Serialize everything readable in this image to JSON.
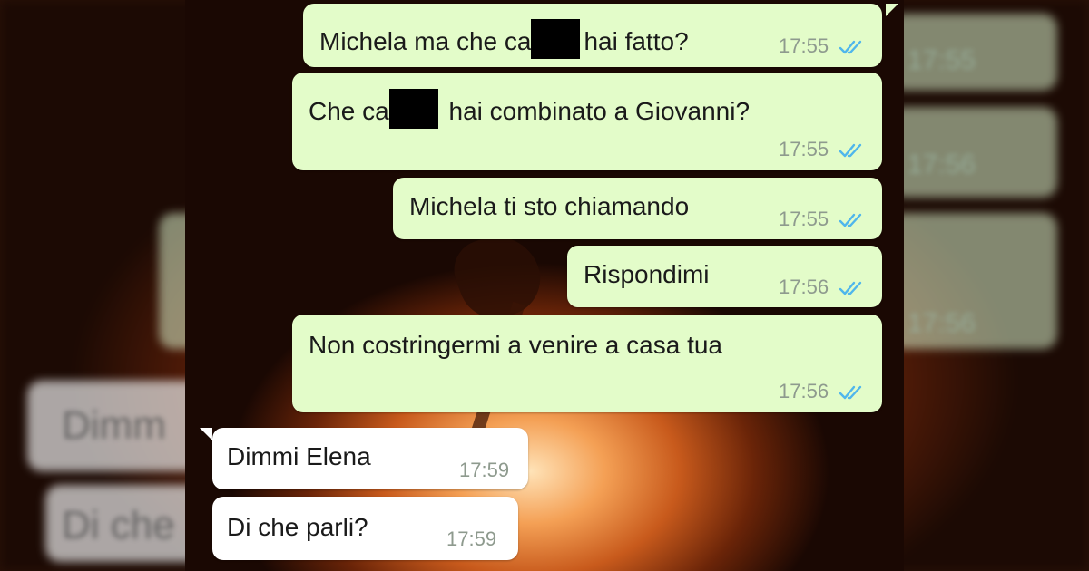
{
  "colors": {
    "outgoing_bubble": "#e3fcc9",
    "incoming_bubble": "#ffffff",
    "read_ticks": "#4fb6ec"
  },
  "messages": [
    {
      "direction": "out",
      "text_before": "Michela ma che ca",
      "censored": true,
      "text_after": "hai fatto?",
      "time": "17:55",
      "status_icon": "double-check-read-icon"
    },
    {
      "direction": "out",
      "text_before": "Che ca",
      "censored": true,
      "text_after": " hai combinato a Giovanni?",
      "time": "17:55",
      "status_icon": "double-check-read-icon"
    },
    {
      "direction": "out",
      "text": "Michela ti sto chiamando",
      "time": "17:55",
      "status_icon": "double-check-read-icon"
    },
    {
      "direction": "out",
      "text": "Rispondimi",
      "time": "17:56",
      "status_icon": "double-check-read-icon"
    },
    {
      "direction": "out",
      "text": "Non costringermi a venire a casa tua",
      "time": "17:56",
      "status_icon": "double-check-read-icon"
    },
    {
      "direction": "in",
      "text": "Dimmi Elena",
      "time": "17:59"
    },
    {
      "direction": "in",
      "text": "Di che parli?",
      "time": "17:59"
    }
  ],
  "blurred_backdrop": {
    "left_fragments": [
      "Dimm",
      "Di che"
    ],
    "right_times": [
      "17:55",
      "17:56",
      "17:56"
    ]
  }
}
